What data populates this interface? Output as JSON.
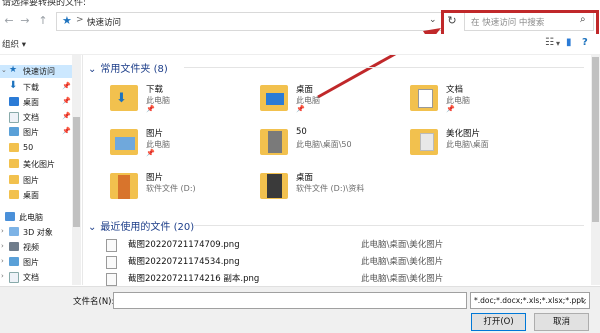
{
  "window": {
    "title": "请选择要转换的文件:"
  },
  "nav": {
    "back_icon": "←",
    "forward_icon": "→",
    "up_icon": "↑",
    "quick_access_icon": "★",
    "breadcrumb_sep": ">",
    "address": "快速访问",
    "dropdown_icon": "⌄",
    "refresh_icon": "↻",
    "search_placeholder": "在 快速访问 中搜索",
    "search_icon": "⌕"
  },
  "toolbar": {
    "organize": "组织 ▾",
    "view_icon": "☷",
    "dropdown": "▾",
    "pane_icon": "▮",
    "help_icon": "?"
  },
  "sidebar": {
    "items": [
      {
        "label": "快速访问",
        "icon": "star-icon",
        "pinned": false
      },
      {
        "label": "下载",
        "icon": "download-icon",
        "pinned": true
      },
      {
        "label": "桌面",
        "icon": "desktop-icon",
        "pinned": true
      },
      {
        "label": "文档",
        "icon": "document-icon",
        "pinned": true
      },
      {
        "label": "图片",
        "icon": "pictures-icon",
        "pinned": true
      },
      {
        "label": "50",
        "icon": "folder-icon",
        "pinned": false
      },
      {
        "label": "美化图片",
        "icon": "folder-icon",
        "pinned": false
      },
      {
        "label": "图片",
        "icon": "folder-icon",
        "pinned": false
      },
      {
        "label": "桌面",
        "icon": "folder-icon",
        "pinned": false
      },
      {
        "label": "此电脑",
        "icon": "computer-icon",
        "pinned": false
      },
      {
        "label": "3D 对象",
        "icon": "3d-icon",
        "pinned": false
      },
      {
        "label": "视频",
        "icon": "video-icon",
        "pinned": false
      },
      {
        "label": "图片",
        "icon": "pictures-icon",
        "pinned": false
      },
      {
        "label": "文档",
        "icon": "document-icon",
        "pinned": false
      }
    ]
  },
  "frequent": {
    "header": "常用文件夹 (8)",
    "tiles": [
      {
        "name": "下载",
        "sub": "此电脑",
        "pinned": true
      },
      {
        "name": "桌面",
        "sub": "此电脑",
        "pinned": true
      },
      {
        "name": "文档",
        "sub": "此电脑",
        "pinned": true
      },
      {
        "name": "图片",
        "sub": "此电脑",
        "pinned": true
      },
      {
        "name": "50",
        "sub": "此电脑\\桌面\\50",
        "pinned": false
      },
      {
        "name": "美化图片",
        "sub": "此电脑\\桌面",
        "pinned": false
      },
      {
        "name": "图片",
        "sub": "软件文件 (D:)",
        "pinned": false
      },
      {
        "name": "桌面",
        "sub": "软件文件 (D:)\\资料",
        "pinned": false
      }
    ]
  },
  "recent": {
    "header": "最近使用的文件 (20)",
    "files": [
      {
        "name": "截图20220721174709.png",
        "path": "此电脑\\桌面\\美化图片"
      },
      {
        "name": "截图20220721174534.png",
        "path": "此电脑\\桌面\\美化图片"
      },
      {
        "name": "截图20220721174216 副本.png",
        "path": "此电脑\\桌面\\美化图片"
      }
    ]
  },
  "bottom": {
    "filename_label": "文件名(N):",
    "filename_value": "",
    "filetype": "*.doc;*.docx;*.xls;*.xlsx;*.ppt;",
    "open": "打开(O)",
    "cancel": "取消"
  },
  "colors": {
    "accent": "#1e73be",
    "highlight": "#c0282a",
    "selection": "#cce8ff",
    "folder": "#f2c14e"
  }
}
